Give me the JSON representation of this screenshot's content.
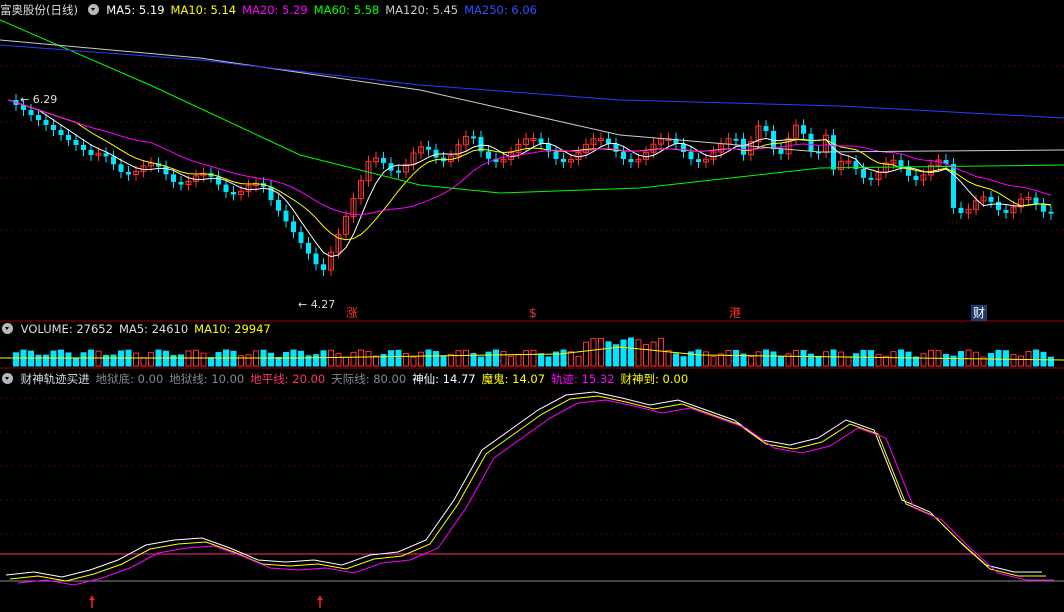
{
  "header_main": {
    "title": "富奥股份(日线)",
    "items": [
      {
        "label": "MA5: 5.19",
        "color": "#ffffff"
      },
      {
        "label": "MA10: 5.14",
        "color": "#ffff00"
      },
      {
        "label": "MA20: 5.29",
        "color": "#ff00ff"
      },
      {
        "label": "MA60: 5.58",
        "color": "#00ff00"
      },
      {
        "label": "MA120: 5.45",
        "color": "#cccccc"
      },
      {
        "label": "MA250: 6.06",
        "color": "#3050ff"
      }
    ]
  },
  "price_labels": {
    "high": "6.29",
    "low": "4.27"
  },
  "event_tags": [
    {
      "label": "涨",
      "color": "#ff3030"
    },
    {
      "label": "$",
      "color": "#ff3030"
    },
    {
      "label": "港",
      "color": "#ff3030"
    },
    {
      "label": "财",
      "color": "#ffffff"
    }
  ],
  "header_volume": {
    "items": [
      {
        "label": "VOLUME: 27652",
        "color": "#dddddd"
      },
      {
        "label": "MA5: 24610",
        "color": "#dddddd"
      },
      {
        "label": "MA10: 29947",
        "color": "#ffff00"
      }
    ]
  },
  "header_indicator": {
    "items": [
      {
        "label": "财神轨迹买进",
        "color": "#dddddd"
      },
      {
        "label": "地狱底: 0.00",
        "color": "#888888"
      },
      {
        "label": "地狱线: 10.00",
        "color": "#888888"
      },
      {
        "label": "地平线: 20.00",
        "color": "#ff3070"
      },
      {
        "label": "天际线: 80.00",
        "color": "#888888"
      },
      {
        "label": "神仙: 14.77",
        "color": "#ffffff"
      },
      {
        "label": "魔鬼: 14.07",
        "color": "#ffff00"
      },
      {
        "label": "轨迹: 15.32",
        "color": "#ff00ff"
      },
      {
        "label": "财神到: 0.00",
        "color": "#ffff00"
      }
    ]
  },
  "colors": {
    "up": "#ff3030",
    "down": "#00e5ff",
    "ma5": "#ffffff",
    "ma10": "#ffff00",
    "ma20": "#ff00ff",
    "ma60": "#00ff00",
    "ma120": "#cccccc",
    "ma250": "#2a3cff"
  }
}
